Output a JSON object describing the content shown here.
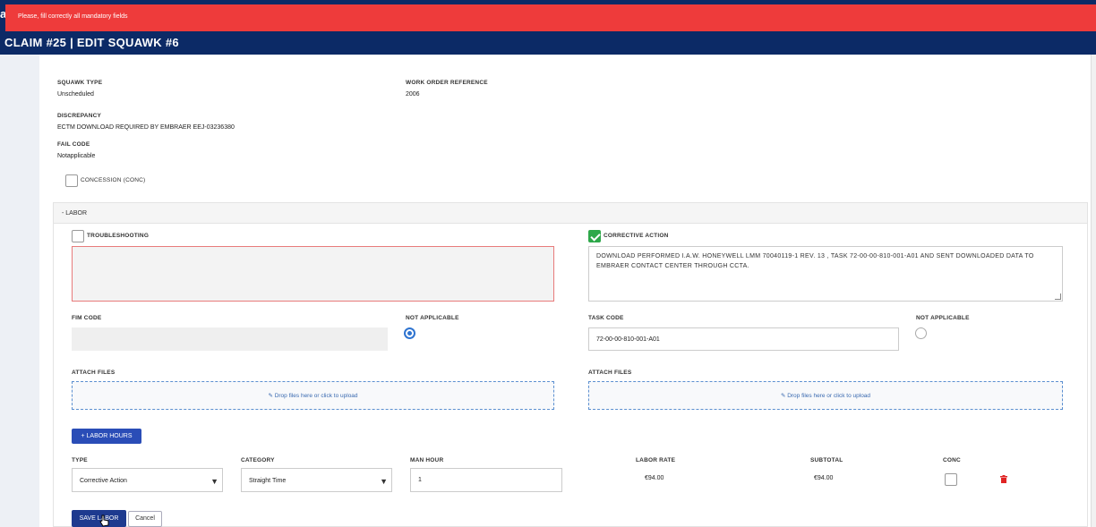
{
  "header": {
    "edge_char": "a",
    "alert": "Please, fill correctly all mandatory fields",
    "title": "CLAIM #25 | EDIT SQUAWK #6"
  },
  "summary": {
    "squawk_type_label": "SQUAWK TYPE",
    "squawk_type_value": "Unscheduled",
    "work_order_label": "WORK ORDER REFERENCE",
    "work_order_value": "2006",
    "discrepancy_label": "DISCREPANCY",
    "discrepancy_value": "ECTM DOWNLOAD REQUIRED BY EMBRAER EEJ-03236380",
    "fail_code_label": "FAIL CODE",
    "fail_code_value": "Notapplicable",
    "concession_label": "CONCESSION (CONC)"
  },
  "labor": {
    "header": "- LABOR",
    "troubleshooting_label": "TROUBLESHOOTING",
    "troubleshooting_value": "",
    "corrective_label": "CORRECTIVE ACTION",
    "corrective_value": "DOWNLOAD PERFORMED I.A.W. HONEYWELL LMM 70040119-1 REV. 13 , TASK 72-00-00-810-001-A01 AND SENT DOWNLOADED DATA TO EMBRAER CONTACT CENTER THROUGH CCTA.",
    "fim_code_label": "FIM CODE",
    "fim_code_value": "",
    "not_applicable_label": "NOT APPLICABLE",
    "task_code_label": "TASK CODE",
    "task_code_value": "72-00-00-810-001-A01",
    "not_applicable_label_2": "NOT APPLICABLE",
    "attach_files_label": "ATTACH FILES",
    "attach_files_label_2": "ATTACH FILES",
    "dropzone_text": "✎ Drop files here or click to upload",
    "dropzone_text_2": "✎ Drop files here or click to upload",
    "add_hours_label": "+ LABOR HOURS",
    "columns": {
      "type": "TYPE",
      "category": "CATEGORY",
      "man_hour": "MAN HOUR",
      "labor_rate": "LABOR RATE",
      "subtotal": "SUBTOTAL",
      "conc": "CONC"
    },
    "row": {
      "type": "Corrective Action",
      "category": "Straight Time",
      "man_hour": "1",
      "labor_rate": "€94.00",
      "subtotal": "€94.00"
    },
    "save_label": "SAVE LABOR",
    "cancel_label": "Cancel"
  },
  "colors": {
    "navy": "#0c2a66",
    "alert": "#ee3b3b",
    "primary": "#2a4db7",
    "success": "#2ea84a",
    "danger": "#e02424"
  },
  "icons": [
    "checkmark-icon",
    "radio-icon",
    "pencil-icon",
    "caret-down-icon",
    "trash-icon",
    "cursor-icon"
  ]
}
